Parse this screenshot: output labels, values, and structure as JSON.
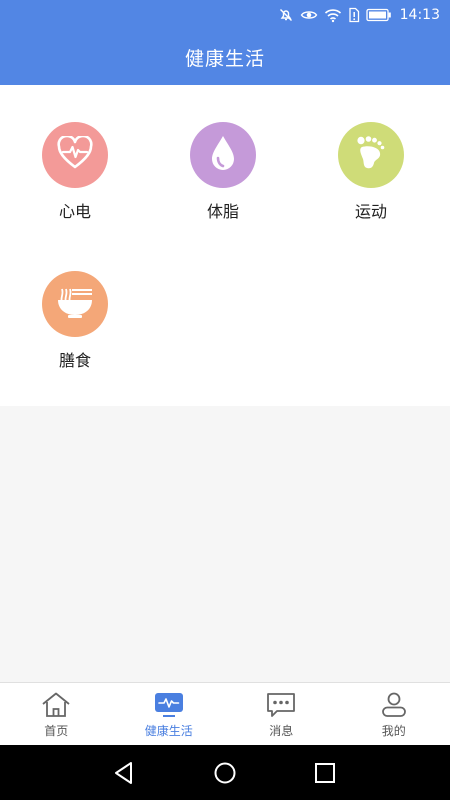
{
  "status_bar": {
    "time": "14:13",
    "icons": [
      "mute-icon",
      "eye-icon",
      "wifi-icon",
      "sim-alert-icon",
      "battery-icon"
    ]
  },
  "header": {
    "title": "健康生活"
  },
  "tiles": [
    {
      "label": "心电",
      "icon": "heart-ecg-icon",
      "color": "#f39a98"
    },
    {
      "label": "体脂",
      "icon": "water-drop-icon",
      "color": "#c59ad9"
    },
    {
      "label": "运动",
      "icon": "footprint-icon",
      "color": "#cfdc78"
    },
    {
      "label": "膳食",
      "icon": "noodle-bowl-icon",
      "color": "#f4a778"
    }
  ],
  "tab_bar": {
    "active_index": 1,
    "active_color": "#4a7fe0",
    "items": [
      {
        "label": "首页",
        "icon": "home-icon"
      },
      {
        "label": "健康生活",
        "icon": "health-monitor-icon"
      },
      {
        "label": "消息",
        "icon": "message-icon"
      },
      {
        "label": "我的",
        "icon": "profile-icon"
      }
    ]
  },
  "colors": {
    "primary": "#5286e4",
    "background": "#f6f6f6"
  }
}
